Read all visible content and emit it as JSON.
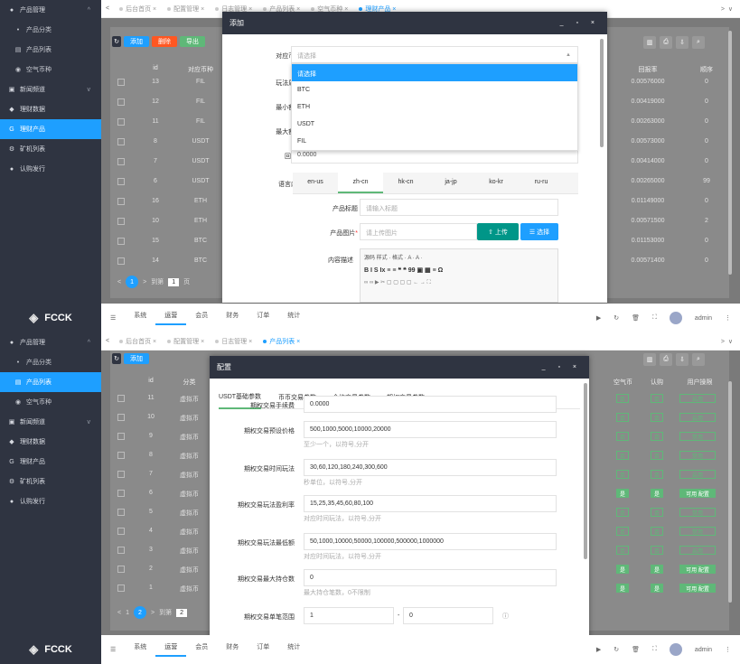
{
  "brand": {
    "name": "FCCK"
  },
  "panel1": {
    "sidebar": [
      {
        "label": "产品管理",
        "icon": "circle-icon",
        "caret": "^",
        "sub": false
      },
      {
        "label": "产品分类",
        "icon": "dot-icon",
        "sub": true
      },
      {
        "label": "产品列表",
        "icon": "list-icon",
        "sub": true
      },
      {
        "label": "空气币种",
        "icon": "coin-icon",
        "sub": true
      },
      {
        "label": "新闻频道",
        "icon": "news-icon",
        "caret": "v",
        "sub": false
      },
      {
        "label": "理财数据",
        "icon": "chart-icon",
        "sub": false
      },
      {
        "label": "理财产品",
        "icon": "g-icon",
        "sub": false,
        "active": true
      },
      {
        "label": "矿机列表",
        "icon": "miner-icon",
        "sub": false
      },
      {
        "label": "认购发行",
        "icon": "issue-icon",
        "sub": false
      }
    ],
    "tabs": [
      {
        "label": "后台首页",
        "on": false
      },
      {
        "label": "配置管理",
        "on": false
      },
      {
        "label": "日志管理",
        "on": false
      },
      {
        "label": "产品列表",
        "on": false
      },
      {
        "label": "空气币种",
        "on": false
      },
      {
        "label": "理财产品",
        "on": true
      }
    ],
    "toolbar": {
      "add": "添加",
      "del": "删除",
      "export": "导出"
    },
    "table": {
      "headers": [
        "id",
        "对应币种",
        "回报率",
        "顺序"
      ],
      "rows": [
        [
          "13",
          "FIL",
          "0.00576000",
          "0"
        ],
        [
          "12",
          "FIL",
          "0.00419000",
          "0"
        ],
        [
          "11",
          "FIL",
          "0.00263000",
          "0"
        ],
        [
          "8",
          "USDT",
          "0.00573000",
          "0"
        ],
        [
          "7",
          "USDT",
          "0.00414000",
          "0"
        ],
        [
          "6",
          "USDT",
          "0.00265000",
          "99"
        ],
        [
          "16",
          "ETH",
          "0.01149000",
          "0"
        ],
        [
          "10",
          "ETH",
          "0.00571500",
          "2"
        ],
        [
          "15",
          "BTC",
          "0.01153000",
          "0"
        ],
        [
          "14",
          "BTC",
          "0.00571400",
          "0"
        ]
      ]
    },
    "pager": {
      "current": "1",
      "goto": "到第",
      "page": "1",
      "unit": "页"
    },
    "dialog": {
      "title": "添加",
      "controls": "_ ▫ ×",
      "fields": {
        "coin_label": "对应币种",
        "coin_placeholder": "请选择",
        "play_label": "玩法周期",
        "min_label": "最小额度",
        "max_label": "最大额度",
        "rate_label": "回报率",
        "rate_value": "0.0000",
        "lang_label": "语言内容"
      },
      "dropdown": [
        "请选择",
        "BTC",
        "ETH",
        "USDT",
        "FIL"
      ],
      "lang_tabs": [
        "en-us",
        "zh-cn",
        "hk-cn",
        "ja-jp",
        "ko-kr",
        "ru-ru"
      ],
      "product_title_label": "产品标题",
      "product_title_ph": "请输入标题",
      "product_img_label": "产品图片",
      "product_img_ph": "请上传图片",
      "upload": "上传",
      "choose": "选择",
      "desc_label": "内容描述",
      "editor_row1": "源码  样式  ·  格式  ·  A · A ·",
      "editor_row2": "B I S Ix  ≡ ≡  ❝ ❝ 99  ▣ ▦ ≡ Ω",
      "editor_row3": "∞ ∞ ▶ ✂ ▢ ▢ ▢ ▢ ← → ⛶"
    },
    "bottom": [
      "系统",
      "运营",
      "会员",
      "财务",
      "订单",
      "统计"
    ],
    "bottom_active": "运营",
    "user": "admin"
  },
  "panel2": {
    "sidebar": [
      {
        "label": "产品管理",
        "icon": "circle-icon",
        "caret": "^",
        "sub": false
      },
      {
        "label": "产品分类",
        "icon": "dot-icon",
        "sub": true
      },
      {
        "label": "产品列表",
        "icon": "list-icon",
        "sub": true,
        "active": true
      },
      {
        "label": "空气币种",
        "icon": "coin-icon",
        "sub": true
      },
      {
        "label": "新闻频道",
        "icon": "news-icon",
        "caret": "v",
        "sub": false
      },
      {
        "label": "理财数据",
        "icon": "chart-icon",
        "sub": false
      },
      {
        "label": "理财产品",
        "icon": "g-icon",
        "sub": false
      },
      {
        "label": "矿机列表",
        "icon": "miner-icon",
        "sub": false
      },
      {
        "label": "认购发行",
        "icon": "issue-icon",
        "sub": false
      }
    ],
    "tabs": [
      {
        "label": "后台首页",
        "on": false
      },
      {
        "label": "配置管理",
        "on": false
      },
      {
        "label": "日志管理",
        "on": false
      },
      {
        "label": "产品列表",
        "on": true
      }
    ],
    "toolbar": {
      "add": "添加"
    },
    "table": {
      "headers": [
        "id",
        "分类",
        "空气币",
        "认购",
        "用户操限"
      ],
      "rows": [
        [
          "11",
          "虚拟币",
          "否",
          "启用"
        ],
        [
          "10",
          "虚拟币",
          "否",
          "启用"
        ],
        [
          "9",
          "虚拟币",
          "否",
          "禁用"
        ],
        [
          "8",
          "虚拟币",
          "否",
          "禁用"
        ],
        [
          "7",
          "虚拟币",
          "否",
          "启用"
        ],
        [
          "6",
          "虚拟币",
          "是",
          "可用 配置"
        ],
        [
          "5",
          "虚拟币",
          "否",
          "禁用"
        ],
        [
          "4",
          "虚拟币",
          "否",
          "禁用"
        ],
        [
          "3",
          "虚拟币",
          "否",
          "启用"
        ],
        [
          "2",
          "虚拟币",
          "是",
          "可用 配置"
        ],
        [
          "1",
          "虚拟币",
          "是",
          "可用 配置"
        ]
      ]
    },
    "pager": {
      "p1": "1",
      "current": "2",
      "goto": "到第",
      "page": "2"
    },
    "dialog": {
      "title": "配置",
      "controls": "_ ▫ ×",
      "tabs": [
        "USDT基础参数",
        "币币交易参数",
        "合约交易参数",
        "期权交易参数"
      ],
      "fields": [
        {
          "label": "期权交易手续费",
          "value": "0.0000",
          "hint": ""
        },
        {
          "label": "期权交易预设价格",
          "value": "500,1000,5000,10000,20000",
          "hint": "至少一个，以符号,分开"
        },
        {
          "label": "期权交易时间玩法",
          "value": "30,60,120,180,240,300,600",
          "hint": "秒单位，以符号,分开"
        },
        {
          "label": "期权交易玩法盈利率",
          "value": "15,25,35,45,60,80,100",
          "hint": "对应时间玩法，以符号,分开"
        },
        {
          "label": "期权交易玩法最低额",
          "value": "50,1000,10000,50000,100000,500000,1000000",
          "hint": "对应时间玩法，以符号,分开"
        },
        {
          "label": "期权交易最大持仓数",
          "value": "0",
          "hint": "最大持仓笔数，0不限制"
        },
        {
          "label": "期权交易单笔范围",
          "value": "1",
          "value2": "0",
          "hint": ""
        }
      ]
    },
    "bottom": [
      "系统",
      "运营",
      "会员",
      "财务",
      "订单",
      "统计"
    ],
    "bottom_active": "运营",
    "user": "admin"
  }
}
